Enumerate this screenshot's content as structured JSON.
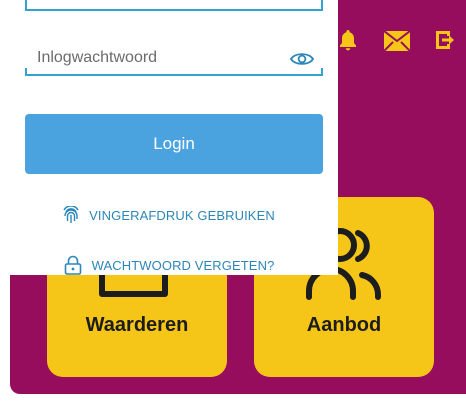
{
  "login": {
    "password_placeholder": "Inlogwachtwoord",
    "login_label": "Login",
    "fingerprint_label": "VINGERAFDRUK GEBRUIKEN",
    "forgot_label": "WACHTWOORD VERGETEN?"
  },
  "tiles": [
    {
      "label": "Waarderen"
    },
    {
      "label": "Aanbod"
    }
  ],
  "colors": {
    "background": "#970d5e",
    "tile": "#f5c518",
    "button": "#4aa2df",
    "link": "#2d86b8",
    "field_underline": "#34a3cf"
  },
  "icons": {
    "topbar": [
      "bell-icon",
      "mail-icon",
      "logout-icon"
    ],
    "fingerprint": "fingerprint-icon",
    "lock": "lock-icon",
    "eye": "eye-icon"
  }
}
